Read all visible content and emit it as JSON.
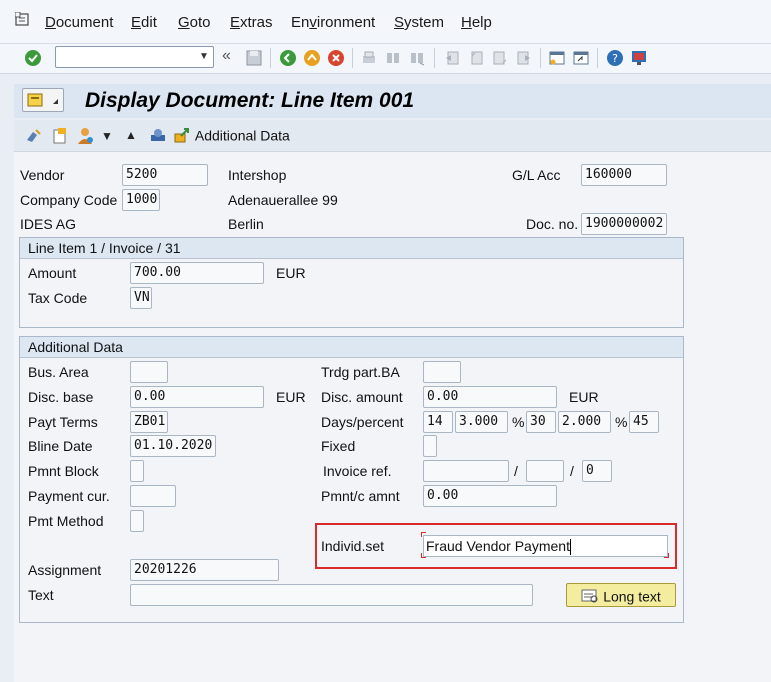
{
  "menu": {
    "items": [
      "Document",
      "Edit",
      "Goto",
      "Extras",
      "Environment",
      "System",
      "Help"
    ],
    "underline": [
      "D",
      "E",
      "G",
      "E",
      "v",
      "S",
      "H"
    ]
  },
  "toolbar": {
    "command_value": ""
  },
  "title": "Display Document: Line Item 001",
  "app_toolbar": {
    "additional_data": "Additional Data"
  },
  "header": {
    "vendor_label": "Vendor",
    "vendor_value": "5200",
    "vendor_name": "Intershop",
    "gl_label": "G/L Acc",
    "gl_value": "160000",
    "company_code_label": "Company Code",
    "company_code_value": "1000",
    "street": "Adenauerallee 99",
    "company_name": "IDES AG",
    "city": "Berlin",
    "doc_no_label": "Doc. no.",
    "doc_no_value": "1900000002"
  },
  "line_item": {
    "heading": "Line Item 1 / Invoice / 31",
    "amount_label": "Amount",
    "amount_value": "700.00",
    "currency": "EUR",
    "tax_code_label": "Tax Code",
    "tax_code_value": "VN"
  },
  "additional": {
    "heading": "Additional Data",
    "bus_area_label": "Bus. Area",
    "bus_area_value": "",
    "trdg_label": "Trdg part.BA",
    "trdg_value": "",
    "disc_base_label": "Disc. base",
    "disc_base_value": "0.00",
    "disc_base_currency": "EUR",
    "disc_amount_label": "Disc. amount",
    "disc_amount_value": "0.00",
    "disc_amount_currency": "EUR",
    "payt_terms_label": "Payt Terms",
    "payt_terms_value": "ZB01",
    "days_label": "Days/percent",
    "days1": "14",
    "pct1": "3.000",
    "days2": "30",
    "pct2": "2.000",
    "days3": "45",
    "pct_sign": "%",
    "bline_label": "Bline Date",
    "bline_value": "01.10.2020",
    "fixed_label": "Fixed",
    "pmnt_block_label": "Pmnt Block",
    "invoice_ref_label": "Invoice ref.",
    "invoice_ref_sep": "/",
    "invoice_ref_last": "0",
    "payment_cur_label": "Payment cur.",
    "pmnt_c_label": "Pmnt/c amnt",
    "pmnt_c_value": "0.00",
    "pmt_method_label": "Pmt Method",
    "indiv_label": "Individ.set",
    "indiv_value": "Fraud Vendor Payment",
    "assignment_label": "Assignment",
    "assignment_value": "20201226",
    "text_label": "Text",
    "text_value": "",
    "long_text_button": "Long text"
  },
  "colors": {
    "highlight": "#d92b2b",
    "button": "#f4eda0",
    "group_header": "#dde7f2"
  }
}
